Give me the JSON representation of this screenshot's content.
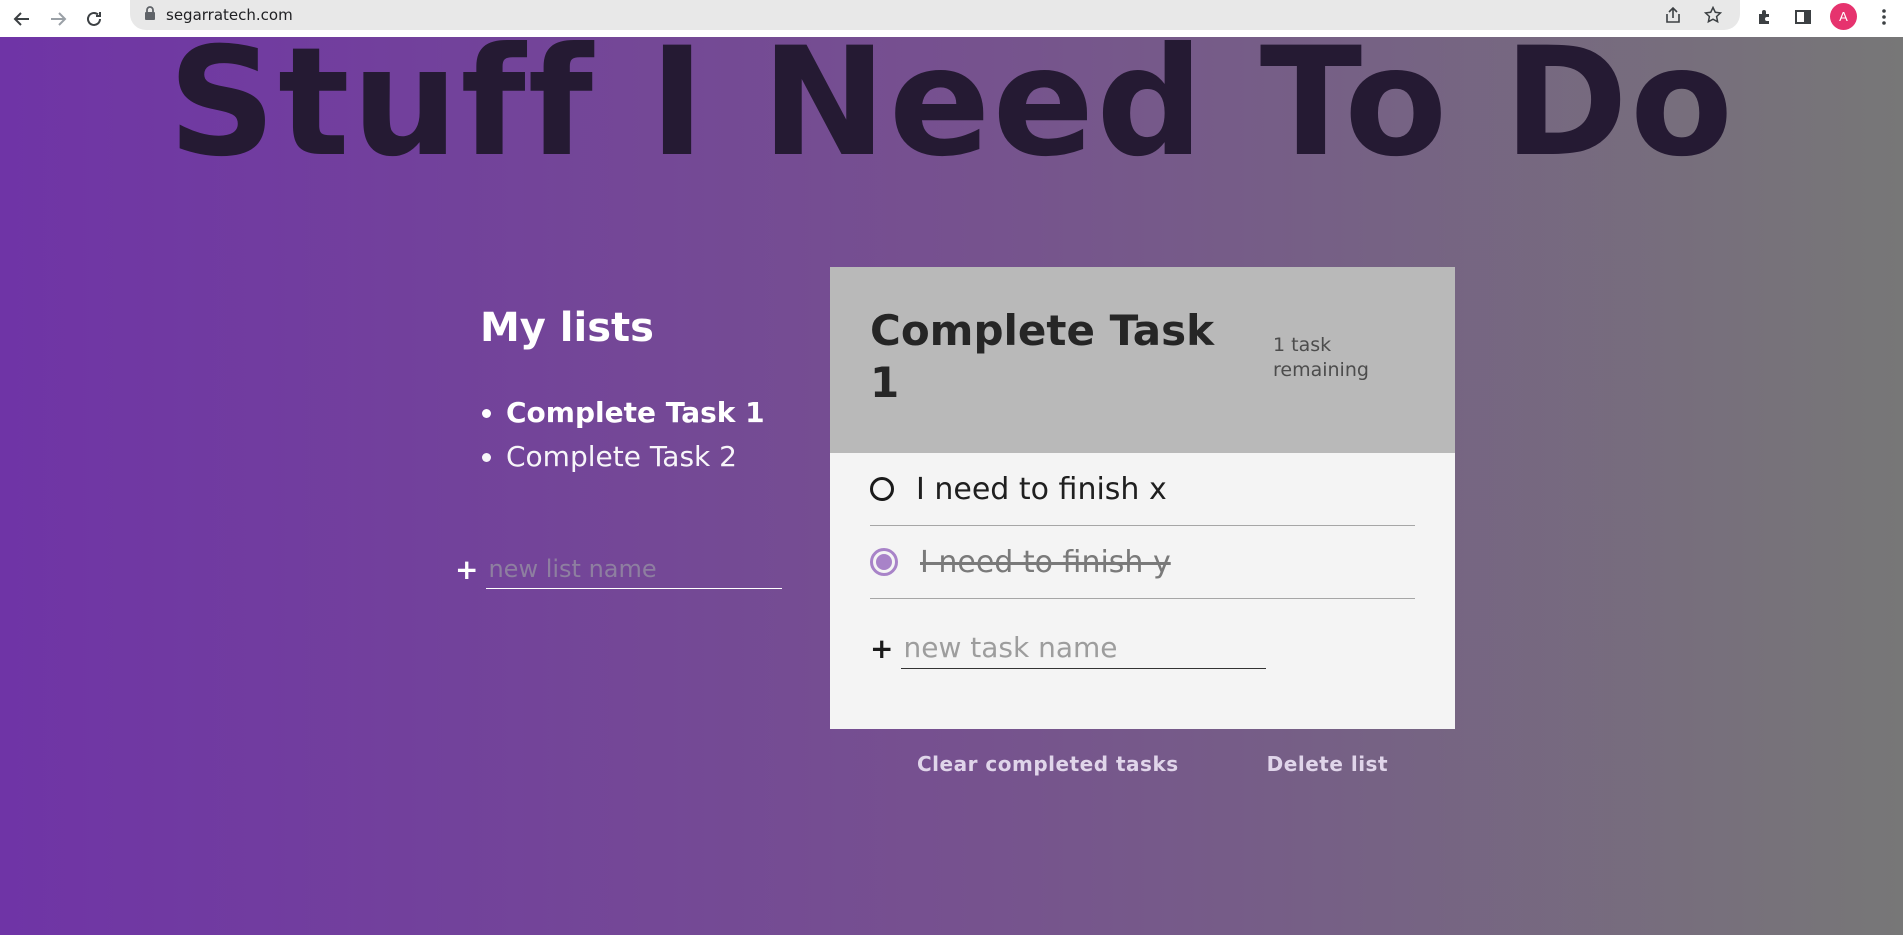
{
  "browser": {
    "url": "segarratech.com",
    "profile_initial": "A",
    "icons": [
      "back-arrow-icon",
      "forward-arrow-icon",
      "reload-icon",
      "lock-icon",
      "share-icon",
      "star-icon",
      "extensions-icon",
      "side-panel-icon",
      "kebab-menu-icon"
    ]
  },
  "page": {
    "title": "Stuff I Need To Do"
  },
  "sidebar": {
    "heading": "My lists",
    "lists": [
      {
        "label": "Complete Task 1",
        "active": true
      },
      {
        "label": "Complete Task 2",
        "active": false
      }
    ],
    "new_list_placeholder": "new list name",
    "plus": "+"
  },
  "active_list": {
    "title": "Complete Task 1",
    "remaining": "1 task remaining",
    "tasks": [
      {
        "label": "I need to finish x",
        "completed": false
      },
      {
        "label": "I need to finish y",
        "completed": true
      }
    ],
    "new_task_placeholder": "new task name",
    "plus": "+"
  },
  "actions": {
    "clear_completed": "Clear completed tasks",
    "delete_list": "Delete list"
  },
  "colors": {
    "gradient_start": "#6f34a6",
    "gradient_end": "#777777",
    "title": "#251a33",
    "checkbox_checked": "#a883c8",
    "avatar": "#e6336e"
  }
}
